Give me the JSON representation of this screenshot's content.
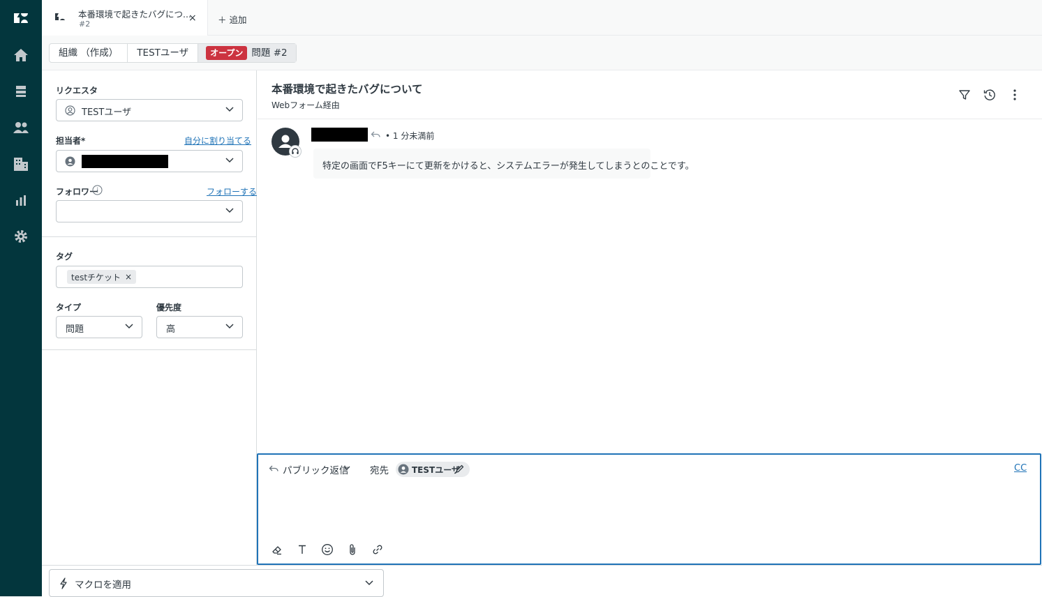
{
  "nav": {
    "items": [
      "logo-icon",
      "home-icon",
      "views-icon",
      "customers-icon",
      "organizations-icon",
      "reporting-icon",
      "admin-gear-icon"
    ]
  },
  "tabs": {
    "active": {
      "title": "本番環境で起きたバグにつ...",
      "subtitle": "#2",
      "close": "×"
    },
    "add_label": "＋ 追加"
  },
  "breadcrumb": {
    "org": "組織 （作成）",
    "user": "TESTユーザ",
    "status": "オープン",
    "ticket": "問題 #2"
  },
  "properties": {
    "requester_label": "リクエスタ",
    "requester_value": "TESTユーザ",
    "assignee_label": "担当者*",
    "assign_self_link": "自分に割り当てる",
    "followers_label": "フォロワー",
    "follow_link": "フォローする",
    "tags_label": "タグ",
    "tags": [
      "testチケット"
    ],
    "type_label": "タイプ",
    "type_value": "問題",
    "priority_label": "優先度",
    "priority_value": "高"
  },
  "conversation": {
    "subject": "本番環境で起きたバグについて",
    "channel": "Webフォーム経由",
    "message": {
      "time": "•  1 分未満前",
      "body": "特定の画面でF5キーにて更新をかけると、システムエラーが発生してしまうとのことです。"
    }
  },
  "composer": {
    "reply_type": "パブリック返信",
    "to_label": "宛先",
    "recipient": "TESTユーザ",
    "cc_label": "CC",
    "tools": [
      "eraser-icon",
      "text-format-icon",
      "emoji-icon",
      "attachment-icon",
      "link-icon"
    ]
  },
  "footer": {
    "macro_label": "マクロを適用"
  },
  "colors": {
    "nav_bg": "#03363d",
    "status_open": "#cc3340",
    "link": "#1f73b7",
    "focus": "#1f73b7"
  }
}
